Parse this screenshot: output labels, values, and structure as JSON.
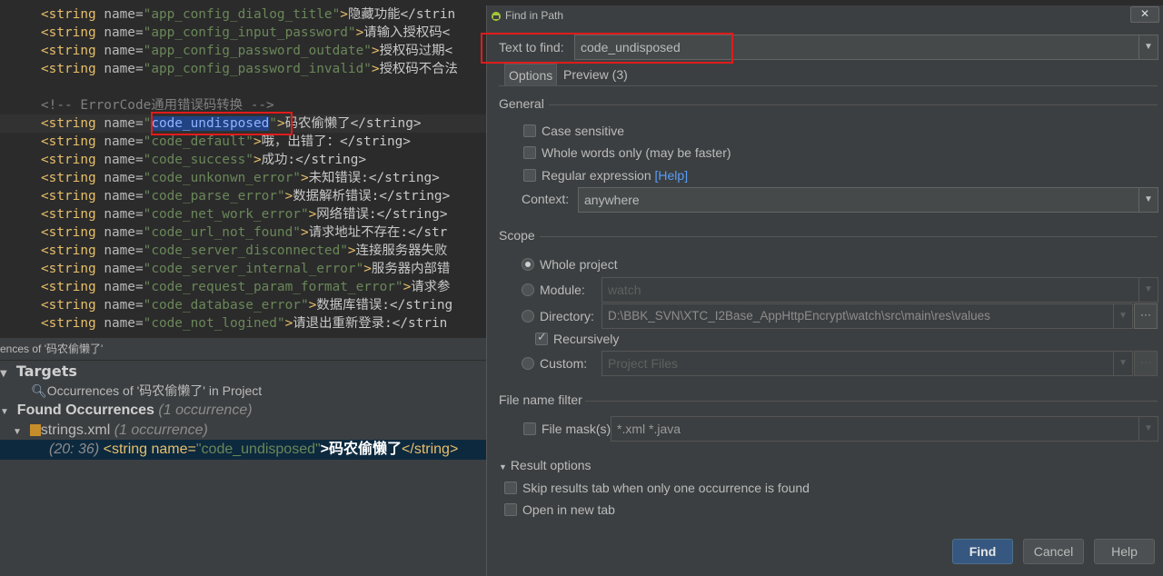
{
  "editor": {
    "lines": [
      {
        "name": "app_config_dialog_title",
        "text": "隐藏功能</strin"
      },
      {
        "name": "app_config_input_password",
        "text": "请输入授权码<"
      },
      {
        "name": "app_config_password_outdate",
        "text": "授权码过期<"
      },
      {
        "name": "app_config_password_invalid",
        "text": "授权码不合法"
      },
      {
        "comment": "<!-- ErrorCode通用错误码转换 -->"
      },
      {
        "name": "code_undisposed",
        "text": "码农偷懒了</string>"
      },
      {
        "name": "code_default",
        "text": "哦，出错了：</string>"
      },
      {
        "name": "code_success",
        "text": "成功:</string>"
      },
      {
        "name": "code_unkonwn_error",
        "text": "未知错误:</string>"
      },
      {
        "name": "code_parse_error",
        "text": "数据解析错误:</string>"
      },
      {
        "name": "code_net_work_error",
        "text": "网络错误:</string>"
      },
      {
        "name": "code_url_not_found",
        "text": "请求地址不存在:</str"
      },
      {
        "name": "code_server_disconnected",
        "text": "连接服务器失败"
      },
      {
        "name": "code_server_internal_error",
        "text": "服务器内部错"
      },
      {
        "name": "code_request_param_format_error",
        "text": "请求参"
      },
      {
        "name": "code_database_error",
        "text": "数据库错误:</string"
      },
      {
        "name": "code_not_logined",
        "text": "请退出重新登录:</strin"
      }
    ]
  },
  "find_panel": {
    "title": "ences of '码农偷懒了'",
    "targets": "Targets",
    "occurrences_in_project": "Occurrences of '码农偷懒了' in Project",
    "found_occurrences": "Found Occurrences",
    "found_count": "(1 occurrence)",
    "file": "strings.xml",
    "file_count": "(1 occurrence)",
    "result_pos": "(20: 36)",
    "result_code_pre": "<string name=",
    "result_code_val": "\"code_undisposed\"",
    "result_code_text": ">码农偷懒了",
    "result_code_close": "</string>"
  },
  "dialog": {
    "title": "Find in Path",
    "close": "✕",
    "text_to_find_label": "Text to find:",
    "text_to_find_value": "code_undisposed",
    "tabs": [
      {
        "label": "Options"
      },
      {
        "label": "Preview (3)"
      }
    ],
    "general": "General",
    "case_sensitive": "Case sensitive",
    "whole_words": "Whole words only (may be faster)",
    "regex": "Regular expression",
    "help_link": "[Help]",
    "context_label": "Context:",
    "context_value": "anywhere",
    "scope": "Scope",
    "whole_project": "Whole project",
    "module": "Module:",
    "module_value": "watch",
    "directory": "Directory:",
    "directory_value": "D:\\BBK_SVN\\XTC_I2Base_AppHttpEncrypt\\watch\\src\\main\\res\\values",
    "recursively": "Recursively",
    "custom": "Custom:",
    "custom_value": "Project Files",
    "file_name_filter": "File name filter",
    "file_mask": "File mask(s)",
    "file_mask_value": "*.xml *.java",
    "result_options": "Result options",
    "skip_results": "Skip results tab when only one occurrence is found",
    "open_new_tab": "Open in new tab",
    "find_btn": "Find",
    "cancel_btn": "Cancel",
    "help_btn": "Help"
  }
}
